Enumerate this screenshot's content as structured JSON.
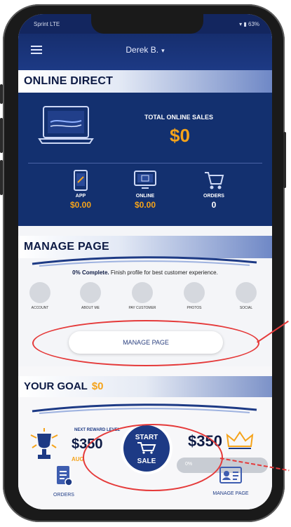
{
  "status_bar": {
    "carrier": "Sprint LTE",
    "right": "▾ ▮ 63%"
  },
  "header": {
    "user_name": "Derek B.",
    "caret": "▾"
  },
  "online_direct": {
    "title": "ONLINE DIRECT",
    "total_label": "TOTAL ONLINE SALES",
    "total_value": "$0",
    "stats": [
      {
        "label": "APP",
        "value": "$0.00"
      },
      {
        "label": "ONLINE",
        "value": "$0.00"
      },
      {
        "label": "ORDERS",
        "value": "0"
      }
    ]
  },
  "manage_page": {
    "title": "MANAGE PAGE",
    "complete_bold": "0% Complete.",
    "complete_rest": " Finish profile for best customer experience.",
    "items": [
      "ACCOUNT",
      "ABOUT ME",
      "PAY CUSTOMER",
      "PHOTOS",
      "SOCIAL"
    ],
    "button_label": "MANAGE PAGE"
  },
  "goal": {
    "title": "YOUR GOAL",
    "amount": "$0",
    "reward_label": "NEXT REWARD LEVEL",
    "reward_value": "$350",
    "reward_sub": "AUG",
    "goal_amount": "$350",
    "progress_label": "0%",
    "progress_fraction": 0
  },
  "tab_bar": {
    "orders_label": "ORDERS",
    "start_line1": "START",
    "start_line2": "SALE",
    "manage_label": "MANAGE PAGE"
  },
  "colors": {
    "navy": "#13306f",
    "accent_orange": "#f5a31a",
    "annotation_red": "#e53a3a"
  }
}
